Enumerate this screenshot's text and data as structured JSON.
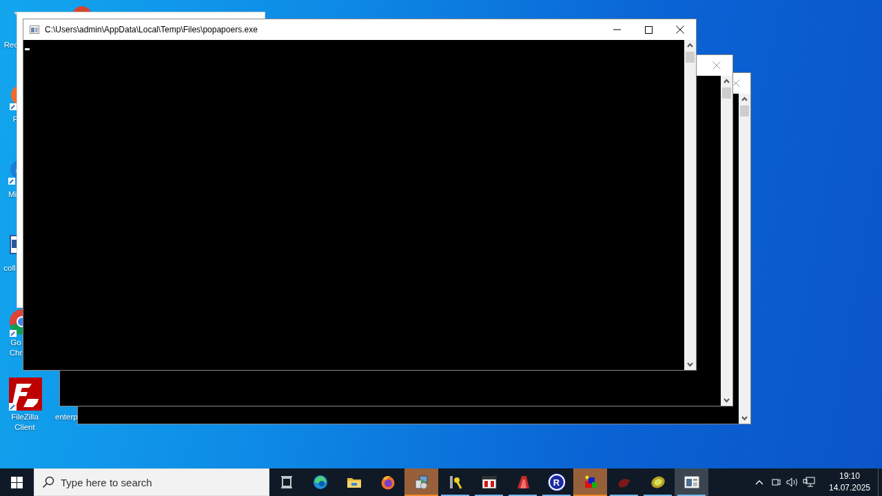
{
  "desktop_icons": [
    {
      "kind": "recycle",
      "lines": [
        "Rec"
      ]
    },
    {
      "kind": "ball"
    },
    {
      "kind": "fox",
      "lines": [
        "F"
      ]
    },
    {
      "kind": "swirl",
      "lines": [
        "Mi"
      ]
    },
    {
      "kind": "doc",
      "lines": [
        "coll"
      ]
    },
    {
      "kind": "chrome",
      "lines": [
        "Go",
        "Chr"
      ]
    },
    {
      "kind": "filezilla",
      "lines": [
        "FileZilla",
        "Client"
      ]
    },
    {
      "kind": "hidden",
      "lines": [
        "enterp"
      ]
    }
  ],
  "console_window": {
    "title": "C:\\Users\\admin\\AppData\\Local\\Temp\\Files\\popapoers.exe"
  },
  "taskbar": {
    "search": {
      "placeholder": "Type here to search"
    },
    "apps": [
      {
        "kind": "taskview",
        "running": false,
        "flashing": false,
        "selected": false
      },
      {
        "kind": "edge",
        "running": false,
        "flashing": false,
        "selected": false
      },
      {
        "kind": "folder",
        "running": false,
        "flashing": false,
        "selected": false
      },
      {
        "kind": "firefox",
        "running": false,
        "flashing": false,
        "selected": false
      },
      {
        "kind": "installer",
        "running": true,
        "flashing": true,
        "selected": false
      },
      {
        "kind": "keys",
        "running": true,
        "flashing": false,
        "selected": false
      },
      {
        "kind": "calendar",
        "running": true,
        "flashing": false,
        "selected": false
      },
      {
        "kind": "redapp",
        "running": true,
        "flashing": false,
        "selected": false
      },
      {
        "kind": "rcircle",
        "glyph": "R",
        "running": true,
        "flashing": false,
        "selected": false
      },
      {
        "kind": "cubes",
        "running": true,
        "flashing": true,
        "selected": false
      },
      {
        "kind": "bug",
        "running": true,
        "flashing": false,
        "selected": false
      },
      {
        "kind": "kiwi",
        "running": true,
        "flashing": false,
        "selected": false
      },
      {
        "kind": "console",
        "running": true,
        "flashing": false,
        "selected": true
      }
    ],
    "clock": {
      "time": "19:10",
      "date": "14.07.2025"
    }
  }
}
